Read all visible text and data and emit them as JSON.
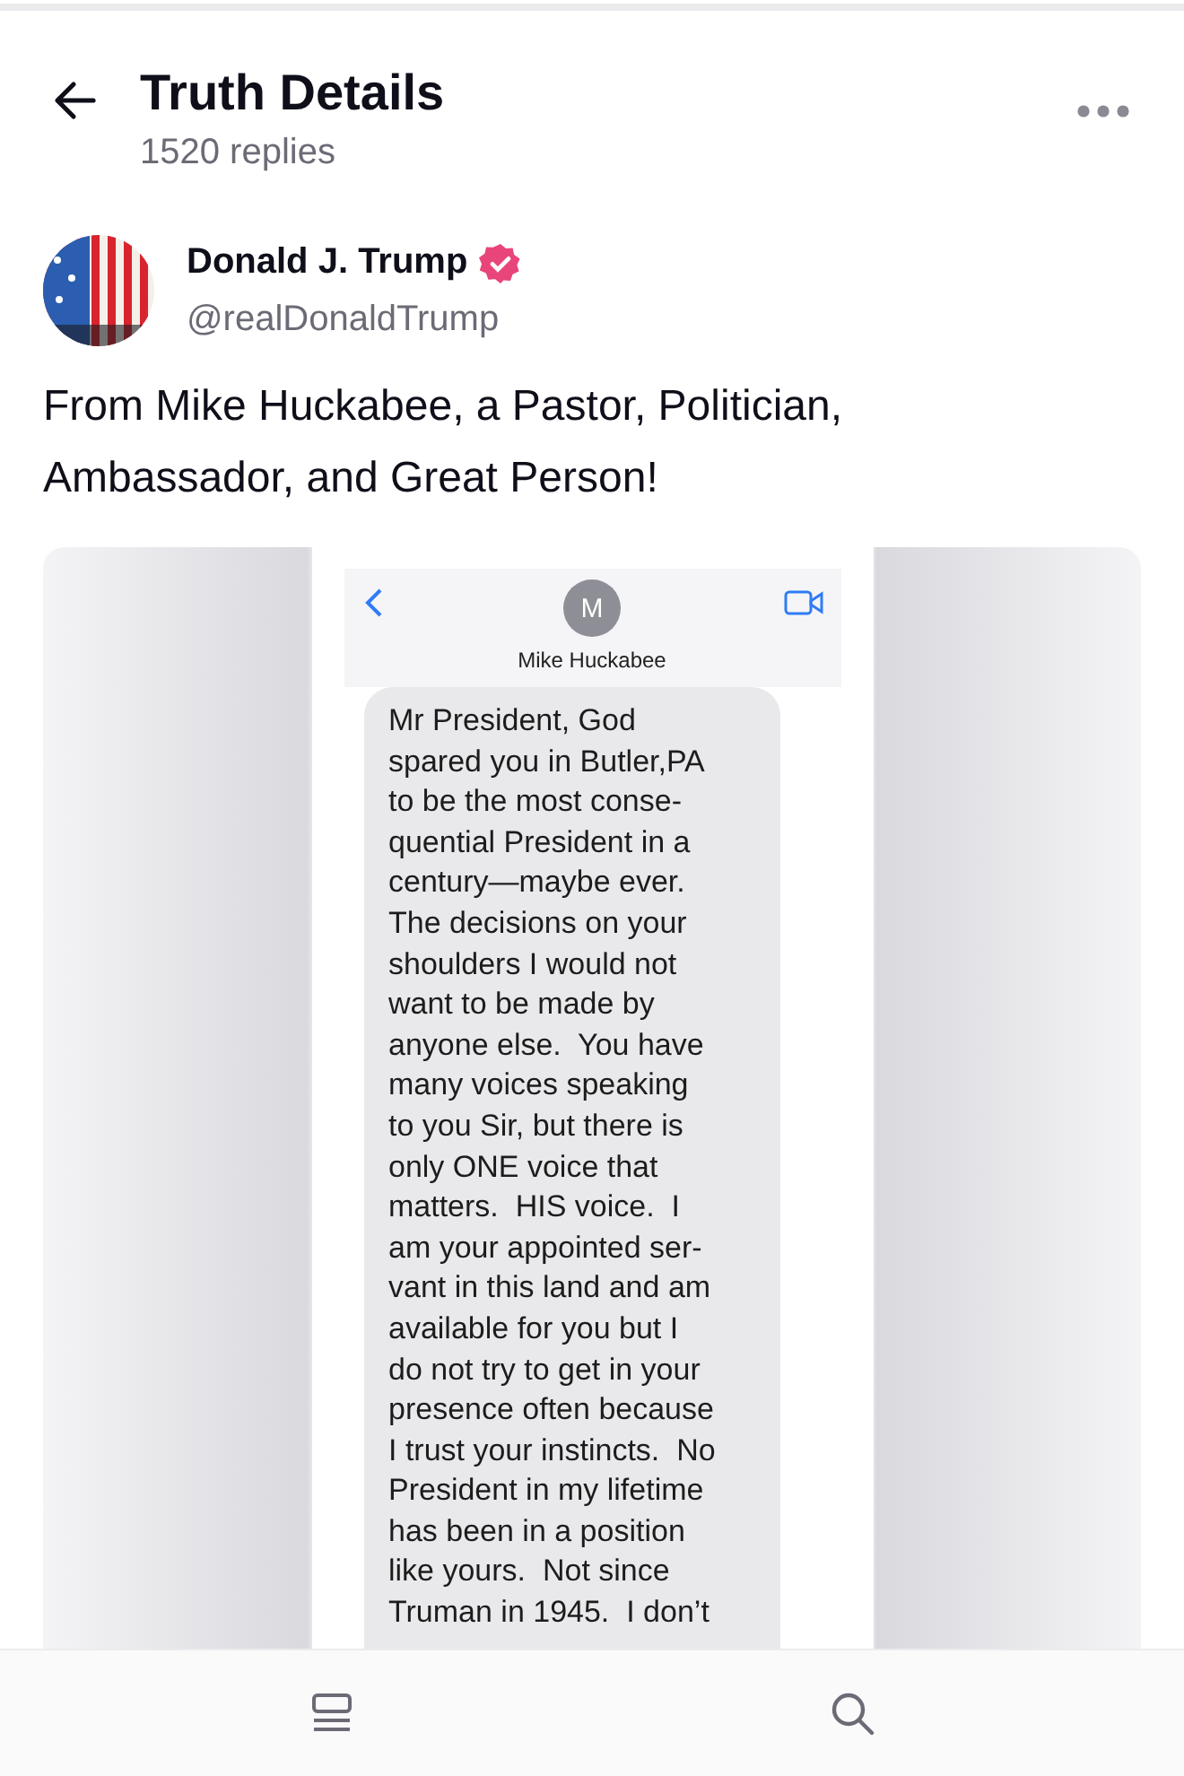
{
  "header": {
    "title": "Truth Details",
    "subtitle": "1520 replies"
  },
  "post": {
    "author": {
      "name": "Donald J. Trump",
      "handle": "@realDonaldTrump",
      "verified": true
    },
    "text": "From Mike Huckabee, a Pastor, Politician, Ambassador, and Great Person!",
    "attachment": {
      "contact_initial": "M",
      "contact_name": "Mike Huckabee",
      "message_lines": [
        "Mr President, God",
        "spared you in Butler,PA",
        "to be the most conse-",
        "quential President in a",
        "century—maybe ever.",
        "The decisions on your",
        "shoulders I would not",
        "want to be made by",
        "anyone else.  You have",
        "many voices speaking",
        "to you Sir, but there is",
        "only ONE voice that",
        "matters.  HIS voice.  I",
        "am your appointed ser-",
        "vant in this land and am",
        "available for you but I",
        "do not try to get in your",
        "presence often because",
        "I trust your instincts.  No",
        "President in my lifetime",
        "has been in a position",
        "like yours.  Not since",
        "Truman in 1945.  I don’t"
      ]
    }
  }
}
